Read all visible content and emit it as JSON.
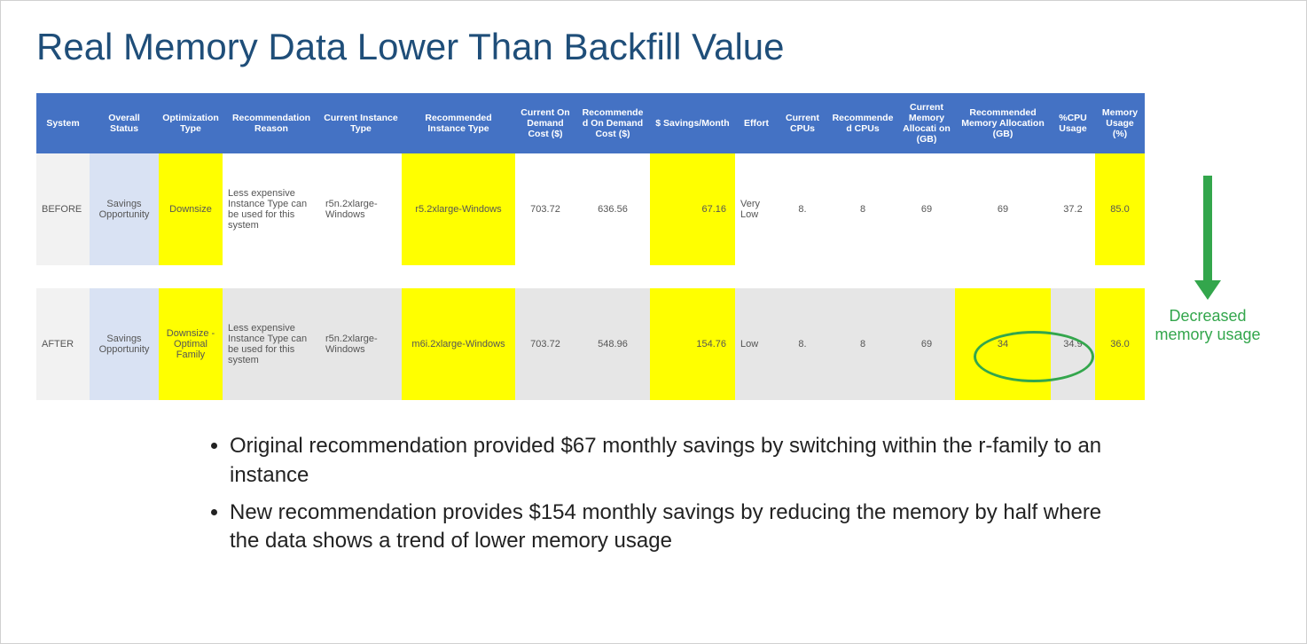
{
  "title": "Real Memory Data Lower Than Backfill Value",
  "headers": [
    "System",
    "Overall Status",
    "Optimization Type",
    "Recommendation Reason",
    "Current Instance Type",
    "Recommended Instance Type",
    "Current On Demand Cost ($)",
    "Recommende d On Demand Cost ($)",
    "$ Savings/Month",
    "Effort",
    "Current CPUs",
    "Recommende d CPUs",
    "Current Memory Allocati on (GB)",
    "Recommended Memory Allocation (GB)",
    "%CPU Usage",
    "Memory Usage (%)"
  ],
  "rows": [
    {
      "system": "BEFORE",
      "status": "Savings Opportunity",
      "optType": "Downsize",
      "reason": "Less expensive Instance Type can be used for this system",
      "currInstance": "r5n.2xlarge-Windows",
      "recInstance": "r5.2xlarge-Windows",
      "currCost": "703.72",
      "recCost": "636.56",
      "savings": "67.16",
      "effort": "Very Low",
      "currCPU": "8.",
      "recCPU": "8",
      "currMem": "69",
      "recMem": "69",
      "cpuPct": "37.2",
      "memPct": "85.0"
    },
    {
      "system": "AFTER",
      "status": "Savings Opportunity",
      "optType": "Downsize - Optimal Family",
      "reason": "Less expensive Instance Type can be used for this system",
      "currInstance": "r5n.2xlarge-Windows",
      "recInstance": "m6i.2xlarge-Windows",
      "currCost": "703.72",
      "recCost": "548.96",
      "savings": "154.76",
      "effort": "Low",
      "currCPU": "8.",
      "recCPU": "8",
      "currMem": "69",
      "recMem": "34",
      "cpuPct": "34.9",
      "memPct": "36.0"
    }
  ],
  "annotation": "Decreased memory usage",
  "bullets": [
    "Original recommendation provided $67 monthly savings by switching within the r-family to an instance",
    "New recommendation provides $154 monthly savings by reducing the memory by half where the data shows a trend of lower memory usage"
  ],
  "colors": {
    "title": "#1f4e79",
    "header": "#4472c4",
    "highlight": "#ffff00",
    "accent": "#33a64c",
    "status": "#d9e2f3"
  },
  "chart_data": {
    "type": "table",
    "title": "Real Memory Data Lower Than Backfill Value",
    "columns": [
      "System",
      "Overall Status",
      "Optimization Type",
      "Recommendation Reason",
      "Current Instance Type",
      "Recommended Instance Type",
      "Current On Demand Cost ($)",
      "Recommended On Demand Cost ($)",
      "$ Savings/Month",
      "Effort",
      "Current CPUs",
      "Recommended CPUs",
      "Current Memory Allocation (GB)",
      "Recommended Memory Allocation (GB)",
      "%CPU Usage",
      "Memory Usage (%)"
    ],
    "rows": [
      [
        "BEFORE",
        "Savings Opportunity",
        "Downsize",
        "Less expensive Instance Type can be used for this system",
        "r5n.2xlarge-Windows",
        "r5.2xlarge-Windows",
        703.72,
        636.56,
        67.16,
        "Very Low",
        8,
        8,
        69,
        69,
        37.2,
        85.0
      ],
      [
        "AFTER",
        "Savings Opportunity",
        "Downsize - Optimal Family",
        "Less expensive Instance Type can be used for this system",
        "r5n.2xlarge-Windows",
        "m6i.2xlarge-Windows",
        703.72,
        548.96,
        154.76,
        "Low",
        8,
        8,
        69,
        34,
        34.9,
        36.0
      ]
    ]
  }
}
